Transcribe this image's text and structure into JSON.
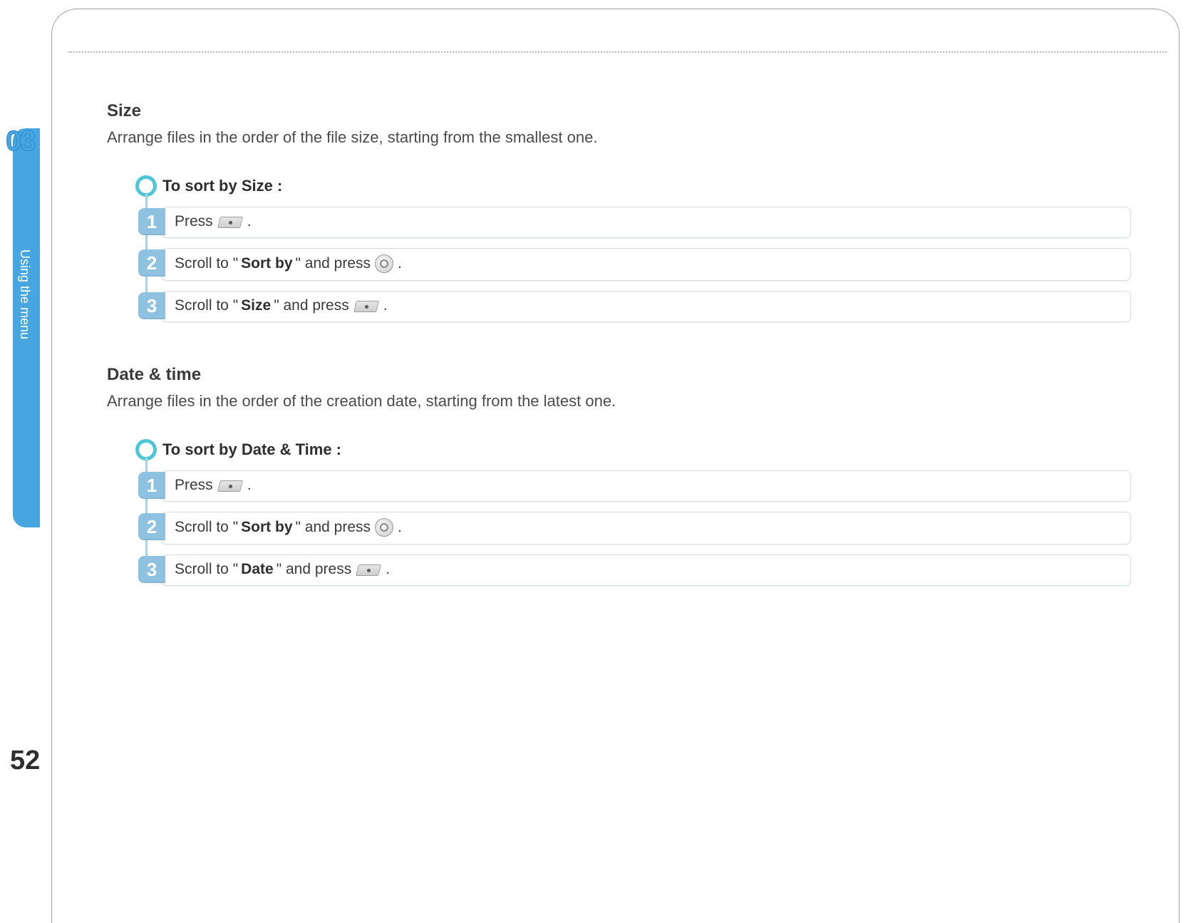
{
  "page": {
    "chapter_number": "03",
    "chapter_label": "Using the menu",
    "page_number": "52"
  },
  "section1": {
    "heading": "Size",
    "description": "Arrange files in the order of the file size, starting from the smallest one.",
    "procedure_title": "To sort by Size :",
    "steps": {
      "s1": {
        "num": "1",
        "t1": "Press ",
        "t2": "."
      },
      "s2": {
        "num": "2",
        "t1": "Scroll to \"",
        "bold": "Sort by",
        "t2": "\" and press ",
        "t3": "."
      },
      "s3": {
        "num": "3",
        "t1": "Scroll to \"",
        "bold": "Size",
        "t2": "\" and press ",
        "t3": "."
      }
    }
  },
  "section2": {
    "heading": "Date & time",
    "description": "Arrange files in the order of the creation date, starting from the latest one.",
    "procedure_title": "To sort by Date & Time :",
    "steps": {
      "s1": {
        "num": "1",
        "t1": "Press ",
        "t2": "."
      },
      "s2": {
        "num": "2",
        "t1": "Scroll to \"",
        "bold": "Sort by",
        "t2": "\" and press ",
        "t3": "."
      },
      "s3": {
        "num": "3",
        "t1": "Scroll to \"",
        "bold": "Date",
        "t2": "\" and press ",
        "t3": "."
      }
    }
  }
}
